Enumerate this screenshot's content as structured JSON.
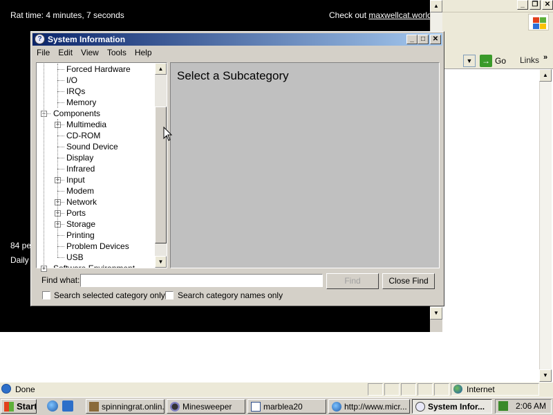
{
  "background_page": {
    "rat_time": "Rat time: 4 minutes, 7 seconds",
    "checkout_prefix": "Check out ",
    "checkout_link": "maxwellcat.world!",
    "line_pct": "84 pe",
    "line_daily": "Daily h"
  },
  "browser": {
    "go_label": "Go",
    "links_label": "Links",
    "status_text": "Done",
    "zone_text": "Internet"
  },
  "window": {
    "title": "System Information",
    "menu": [
      "File",
      "Edit",
      "View",
      "Tools",
      "Help"
    ],
    "tree": [
      {
        "label": "Forced Hardware",
        "level": 2,
        "expander": "none"
      },
      {
        "label": "I/O",
        "level": 2,
        "expander": "none"
      },
      {
        "label": "IRQs",
        "level": 2,
        "expander": "none"
      },
      {
        "label": "Memory",
        "level": 2,
        "expander": "none"
      },
      {
        "label": "Components",
        "level": 1,
        "expander": "minus"
      },
      {
        "label": "Multimedia",
        "level": 2,
        "expander": "plus"
      },
      {
        "label": "CD-ROM",
        "level": 2,
        "expander": "none"
      },
      {
        "label": "Sound Device",
        "level": 2,
        "expander": "none"
      },
      {
        "label": "Display",
        "level": 2,
        "expander": "none"
      },
      {
        "label": "Infrared",
        "level": 2,
        "expander": "none"
      },
      {
        "label": "Input",
        "level": 2,
        "expander": "plus"
      },
      {
        "label": "Modem",
        "level": 2,
        "expander": "none"
      },
      {
        "label": "Network",
        "level": 2,
        "expander": "plus"
      },
      {
        "label": "Ports",
        "level": 2,
        "expander": "plus"
      },
      {
        "label": "Storage",
        "level": 2,
        "expander": "plus"
      },
      {
        "label": "Printing",
        "level": 2,
        "expander": "none"
      },
      {
        "label": "Problem Devices",
        "level": 2,
        "expander": "none"
      },
      {
        "label": "USB",
        "level": 2,
        "expander": "none"
      },
      {
        "label": "Software Environment",
        "level": 1,
        "expander": "plus"
      }
    ],
    "detail_heading": "Select a Subcategory",
    "find_label": "Find what:",
    "find_value": "",
    "find_button": "Find",
    "close_find_button": "Close Find",
    "check_selected": "Search selected category only",
    "check_names": "Search category names only"
  },
  "taskbar": {
    "start_label": "Start",
    "buttons": [
      {
        "label": "spinningrat.onlin..."
      },
      {
        "label": "Minesweeper"
      },
      {
        "label": "marblea20"
      },
      {
        "label": "http://www.micr..."
      },
      {
        "label": "System Infor..."
      }
    ],
    "clock": "2:06 AM"
  },
  "colors": {
    "title_bar_start": "#0a246a",
    "title_bar_end": "#a6caf0",
    "face": "#d4d0c8",
    "detail_bg": "#c0c0c0"
  },
  "icons": {
    "window_icon": "system-information-icon",
    "status_icon": "ie-page-icon",
    "zone_icon": "globe-icon",
    "go_icon": "green-arrow-icon"
  }
}
